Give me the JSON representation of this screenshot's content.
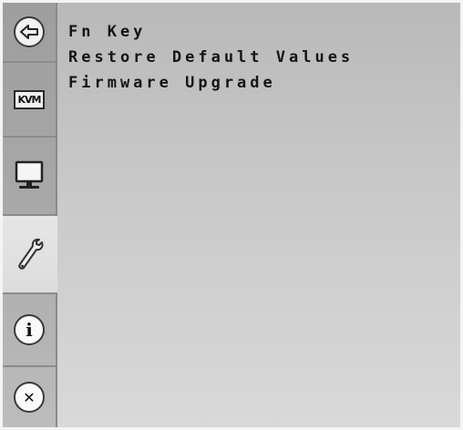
{
  "sidebar": {
    "items": [
      {
        "name": "back",
        "icon": "back-arrow-icon"
      },
      {
        "name": "kvm",
        "icon": "kvm-icon",
        "label": "KVM"
      },
      {
        "name": "display",
        "icon": "monitor-icon"
      },
      {
        "name": "tools",
        "icon": "wrench-icon",
        "selected": true
      },
      {
        "name": "info",
        "icon": "info-icon",
        "label": "i"
      },
      {
        "name": "exit",
        "icon": "close-icon",
        "label": "✕"
      }
    ]
  },
  "menu": {
    "items": [
      {
        "label": "Fn Key"
      },
      {
        "label": "Restore Default Values"
      },
      {
        "label": "Firmware Upgrade"
      }
    ]
  },
  "colors": {
    "panel": "#c4c4c4",
    "sidebar": "#a8a8a8",
    "selected": "#e0e0e0",
    "text": "#151515"
  }
}
